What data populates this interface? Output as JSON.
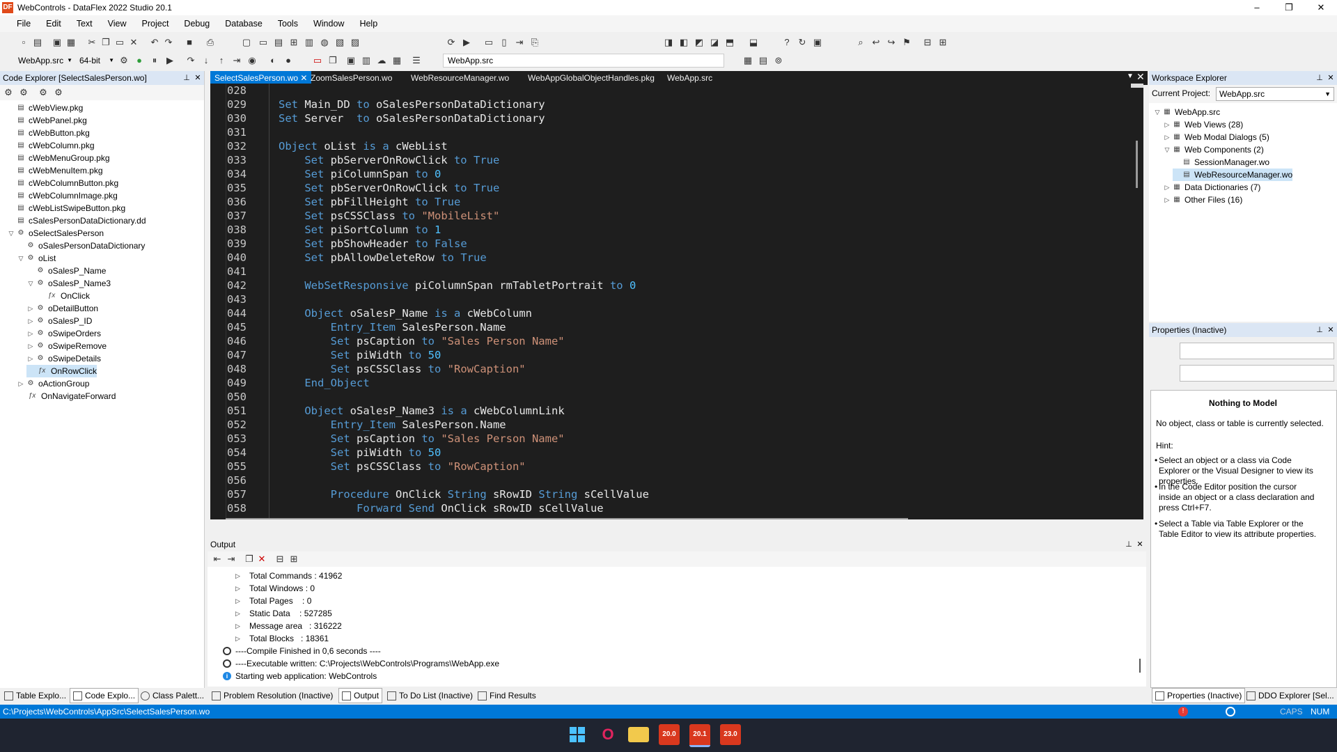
{
  "window": {
    "title": "WebControls - DataFlex 2022 Studio 20.1",
    "app_icon": "DF",
    "controls": [
      "–",
      "❐",
      "✕"
    ]
  },
  "menu": [
    "File",
    "Edit",
    "Text",
    "View",
    "Project",
    "Debug",
    "Database",
    "Tools",
    "Window",
    "Help"
  ],
  "toolbar2": {
    "project_combo": "WebApp.src",
    "bitness_combo": "64-bit",
    "file_box": "WebApp.src"
  },
  "code_explorer": {
    "title": "Code Explorer [SelectSalesPerson.wo]",
    "items": [
      {
        "label": "cWebView.pkg",
        "indent": 0,
        "kind": "file"
      },
      {
        "label": "cWebPanel.pkg",
        "indent": 0,
        "kind": "file"
      },
      {
        "label": "cWebButton.pkg",
        "indent": 0,
        "kind": "file"
      },
      {
        "label": "cWebColumn.pkg",
        "indent": 0,
        "kind": "file"
      },
      {
        "label": "cWebMenuGroup.pkg",
        "indent": 0,
        "kind": "file"
      },
      {
        "label": "cWebMenuItem.pkg",
        "indent": 0,
        "kind": "file"
      },
      {
        "label": "cWebColumnButton.pkg",
        "indent": 0,
        "kind": "file"
      },
      {
        "label": "cWebColumnImage.pkg",
        "indent": 0,
        "kind": "file"
      },
      {
        "label": "cWebListSwipeButton.pkg",
        "indent": 0,
        "kind": "file"
      },
      {
        "label": "cSalesPersonDataDictionary.dd",
        "indent": 0,
        "kind": "file"
      },
      {
        "label": "oSelectSalesPerson",
        "indent": 0,
        "kind": "object",
        "exp": "open"
      },
      {
        "label": "oSalesPersonDataDictionary",
        "indent": 1,
        "kind": "object"
      },
      {
        "label": "oList",
        "indent": 1,
        "kind": "object",
        "exp": "open"
      },
      {
        "label": "oSalesP_Name",
        "indent": 2,
        "kind": "object"
      },
      {
        "label": "oSalesP_Name3",
        "indent": 2,
        "kind": "object",
        "exp": "open"
      },
      {
        "label": "OnClick",
        "indent": 3,
        "kind": "proc"
      },
      {
        "label": "oDetailButton",
        "indent": 2,
        "kind": "object",
        "exp": "closed"
      },
      {
        "label": "oSalesP_ID",
        "indent": 2,
        "kind": "object",
        "exp": "closed"
      },
      {
        "label": "oSwipeOrders",
        "indent": 2,
        "kind": "object",
        "exp": "closed"
      },
      {
        "label": "oSwipeRemove",
        "indent": 2,
        "kind": "object",
        "exp": "closed"
      },
      {
        "label": "oSwipeDetails",
        "indent": 2,
        "kind": "object",
        "exp": "closed"
      },
      {
        "label": "OnRowClick",
        "indent": 2,
        "kind": "proc",
        "selected": true
      },
      {
        "label": "oActionGroup",
        "indent": 1,
        "kind": "object",
        "exp": "closed"
      },
      {
        "label": "OnNavigateForward",
        "indent": 1,
        "kind": "proc"
      }
    ]
  },
  "tabs": [
    {
      "label": "SelectSalesPerson.wo",
      "active": true
    },
    {
      "label": "ZoomSalesPerson.wo"
    },
    {
      "label": "WebResourceManager.wo"
    },
    {
      "label": "WebAppGlobalObjectHandles.pkg"
    },
    {
      "label": "WebApp.src"
    }
  ],
  "code_lines": [
    {
      "n": "028",
      "t": ""
    },
    {
      "n": "029",
      "t": "Set Main_DD to oSalesPersonDataDictionary"
    },
    {
      "n": "030",
      "t": "Set Server  to oSalesPersonDataDictionary"
    },
    {
      "n": "031",
      "t": ""
    },
    {
      "n": "032",
      "t": "Object oList is a cWebList"
    },
    {
      "n": "033",
      "t": "    Set pbServerOnRowClick to True"
    },
    {
      "n": "034",
      "t": "    Set piColumnSpan to 0"
    },
    {
      "n": "035",
      "t": "    Set pbServerOnRowClick to True"
    },
    {
      "n": "036",
      "t": "    Set pbFillHeight to True"
    },
    {
      "n": "037",
      "t": "    Set psCSSClass to \"MobileList\""
    },
    {
      "n": "038",
      "t": "    Set piSortColumn to 1"
    },
    {
      "n": "039",
      "t": "    Set pbShowHeader to False"
    },
    {
      "n": "040",
      "t": "    Set pbAllowDeleteRow to True"
    },
    {
      "n": "041",
      "t": ""
    },
    {
      "n": "042",
      "t": "    WebSetResponsive piColumnSpan rmTabletPortrait to 0"
    },
    {
      "n": "043",
      "t": ""
    },
    {
      "n": "044",
      "t": "    Object oSalesP_Name is a cWebColumn"
    },
    {
      "n": "045",
      "t": "        Entry_Item SalesPerson.Name"
    },
    {
      "n": "046",
      "t": "        Set psCaption to \"Sales Person Name\""
    },
    {
      "n": "047",
      "t": "        Set piWidth to 50"
    },
    {
      "n": "048",
      "t": "        Set psCSSClass to \"RowCaption\""
    },
    {
      "n": "049",
      "t": "    End_Object"
    },
    {
      "n": "050",
      "t": ""
    },
    {
      "n": "051",
      "t": "    Object oSalesP_Name3 is a cWebColumnLink"
    },
    {
      "n": "052",
      "t": "        Entry_Item SalesPerson.Name"
    },
    {
      "n": "053",
      "t": "        Set psCaption to \"Sales Person Name\""
    },
    {
      "n": "054",
      "t": "        Set piWidth to 50"
    },
    {
      "n": "055",
      "t": "        Set psCSSClass to \"RowCaption\""
    },
    {
      "n": "056",
      "t": ""
    },
    {
      "n": "057",
      "t": "        Procedure OnClick String sRowID String sCellValue"
    },
    {
      "n": "058",
      "t": "            Forward Send OnClick sRowID sCellValue"
    }
  ],
  "output": {
    "title": "Output",
    "items": [
      {
        "kind": "tri",
        "t": "Total Commands : 41962"
      },
      {
        "kind": "tri",
        "t": "Total Windows : 0"
      },
      {
        "kind": "tri",
        "t": "Total Pages    : 0"
      },
      {
        "kind": "tri",
        "t": "Static Data    : 527285"
      },
      {
        "kind": "tri",
        "t": "Message area   : 316222"
      },
      {
        "kind": "tri",
        "t": "Total Blocks   : 18361"
      },
      {
        "kind": "circ",
        "t": "----Compile Finished in 0,6 seconds ----"
      },
      {
        "kind": "circ",
        "t": "----Executable written: C:\\Projects\\WebControls\\Programs\\WebApp.exe"
      },
      {
        "kind": "info",
        "t": "Starting web application: WebControls"
      }
    ]
  },
  "workspace": {
    "title": "Workspace Explorer",
    "current_project_label": "Current Project:",
    "current_project": "WebApp.src",
    "tree": [
      {
        "label": "WebApp.src",
        "indent": 0,
        "exp": "open"
      },
      {
        "label": "Web Views (28)",
        "indent": 1,
        "exp": "closed"
      },
      {
        "label": "Web Modal Dialogs (5)",
        "indent": 1,
        "exp": "closed"
      },
      {
        "label": "Web Components (2)",
        "indent": 1,
        "exp": "open"
      },
      {
        "label": "SessionManager.wo",
        "indent": 2
      },
      {
        "label": "WebResourceManager.wo",
        "indent": 2,
        "selected": true
      },
      {
        "label": "Data Dictionaries (7)",
        "indent": 1,
        "exp": "closed"
      },
      {
        "label": "Other Files (16)",
        "indent": 1,
        "exp": "closed"
      }
    ]
  },
  "properties": {
    "title": "Properties (Inactive)",
    "heading": "Nothing to Model",
    "desc": "No object, class or table is currently selected.",
    "hint_label": "Hint:",
    "hints": [
      "Select an object or a class via Code Explorer or the Visual Designer to view its properties.",
      "In the Code Editor position the cursor inside an object or a class declaration and press Ctrl+F7.",
      "Select a Table via Table Explorer or the Table Editor to view its attribute properties."
    ]
  },
  "bottom_tabs_left": [
    "Table Explo...",
    "Code Explo...",
    "Class Palett..."
  ],
  "bottom_tabs_mid": [
    "Problem Resolution (Inactive)",
    "Output",
    "To Do List (Inactive)",
    "Find Results"
  ],
  "bottom_tabs_right": [
    "Properties (Inactive)",
    "DDO Explorer [Sel..."
  ],
  "status": {
    "path": "C:\\Projects\\WebControls\\AppSrc\\SelectSalesPerson.wo",
    "caps": "CAPS",
    "num": "NUM"
  },
  "taskbar": [
    "20.0",
    "20.1",
    "23.0"
  ],
  "colors": {
    "accent": "#0078d7",
    "keyword": "#569cd6",
    "string": "#ce9178",
    "editor_bg": "#1e1e1e"
  }
}
